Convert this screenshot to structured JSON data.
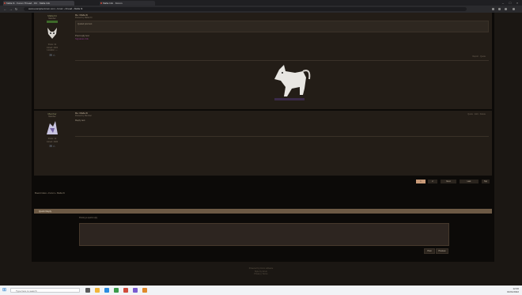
{
  "browser": {
    "tabs": [
      {
        "title": "Mafia fit · Forum Thread · OC · Mafia Info"
      },
      {
        "title": "Mafia Info · Forum"
      }
    ],
    "url": "www.example-forum.com › forum › thread › Mafia fit"
  },
  "posts": [
    {
      "author": "Mafia Fit",
      "rank": "Member",
      "stats": [
        "Posts: 31",
        "Joined: 2021",
        "Location: —"
      ],
      "subject": "Re: Mafia fit",
      "meta": "Posted by Mafia Fit",
      "quote": "Quoted post text",
      "text": "Post reply text",
      "link": "Signature link",
      "right_meta": "Report · Quote"
    },
    {
      "author": "Member",
      "rank": "Member",
      "stats": [
        "Posts: 12",
        "Joined: 2020"
      ],
      "subject": "Re: Mafia fit",
      "meta": "Posted by Member",
      "text": "Reply text",
      "right_meta": "Quote · Edit · Delete"
    }
  ],
  "pagination": [
    {
      "label": "1",
      "active": true
    },
    {
      "label": "2",
      "active": false
    },
    {
      "label": "Next",
      "active": false
    },
    {
      "label": "Last",
      "active": false
    },
    {
      "label": "Top",
      "active": false
    }
  ],
  "breadcrumb": "Board index › Forum › Mafia fit",
  "quick_reply": {
    "title": "Quick Reply",
    "note": "Posting a quick reply",
    "buttons": [
      "Post",
      "Preview"
    ]
  },
  "footer": [
    "Powered by forum software",
    "Style by forum",
    "Privacy | Terms"
  ],
  "taskbar": {
    "search_placeholder": "Type here to search",
    "time": "12:00",
    "date": "01/01/2022"
  }
}
